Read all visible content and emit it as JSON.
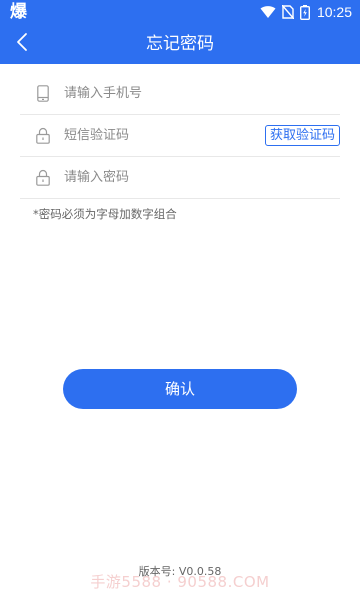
{
  "status_bar": {
    "app_icon_text": "爆",
    "time": "10:25"
  },
  "header": {
    "title": "忘记密码",
    "background_color": "#2d6ff0"
  },
  "form": {
    "phone": {
      "icon": "phone-icon",
      "placeholder": "请输入手机号",
      "value": ""
    },
    "sms_code": {
      "icon": "lock-icon",
      "placeholder": "短信验证码",
      "value": "",
      "get_code_label": "获取验证码"
    },
    "password": {
      "icon": "lock-icon",
      "placeholder": "请输入密码",
      "value": ""
    }
  },
  "hint": "*密码必须为字母加数字组合",
  "confirm_label": "确认",
  "version_text": "版本号: V0.0.58",
  "watermark": "手游5588 · 90588.COM",
  "colors": {
    "accent": "#2d6ff0"
  }
}
